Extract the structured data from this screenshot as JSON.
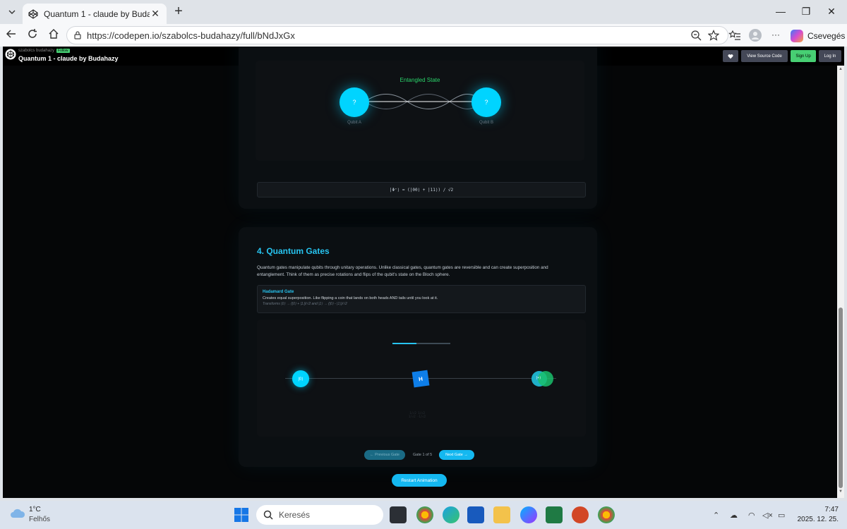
{
  "browser": {
    "tab_title": "Quantum 1 - claude by Budahazy",
    "url": "https://codepen.io/szabolcs-budahazy/full/bNdJxGx",
    "copilot_label": "Csevegés"
  },
  "codepen": {
    "user": "szabolcs budahazy",
    "badge": "Follow",
    "title": "Quantum 1 - claude by Budahazy",
    "view_source_label": "View Source Code",
    "signup_label": "Sign Up",
    "login_label": "Log In"
  },
  "entanglement": {
    "label": "Entangled State",
    "qubit_a_symbol": "?",
    "qubit_b_symbol": "?",
    "qubit_a_caption": "Qubit A",
    "qubit_b_caption": "Qubit B",
    "formula": "|Φ⁺⟩ = (|00⟩ + |11⟩) / √2"
  },
  "gates_section": {
    "title": "4. Quantum Gates",
    "description": "Quantum gates manipulate qubits through unitary operations. Unlike classical gates, quantum gates are reversible and can create superposition and entanglement. Think of them as precise rotations and flips of the qubit's state on the Bloch sphere.",
    "gate_name": "Hadamard Gate",
    "gate_text": "Creates equal superposition. Like flipping a coin that lands on both heads AND tails until you look at it.",
    "gate_transform": "Transforms |0⟩ → (|0⟩ + |1⟩)/√2 and |1⟩ → (|0⟩ - |1⟩)/√2",
    "input_state": "|0⟩",
    "gate_symbol": "H",
    "output_state": "|+⟩",
    "ghost_math_line1": "1/√2  1/√2",
    "ghost_math_line2": "1/√2 -1/√2",
    "progress": 0.42,
    "prev_label": "← Previous Gate",
    "counter": "Gate 1 of 5",
    "next_label": "Next Gate →",
    "restart_label": "Restart Animation"
  },
  "taskbar": {
    "temperature": "1°C",
    "condition": "Felhős",
    "search_placeholder": "Keresés",
    "time": "7:47",
    "date": "2025. 12. 25."
  }
}
